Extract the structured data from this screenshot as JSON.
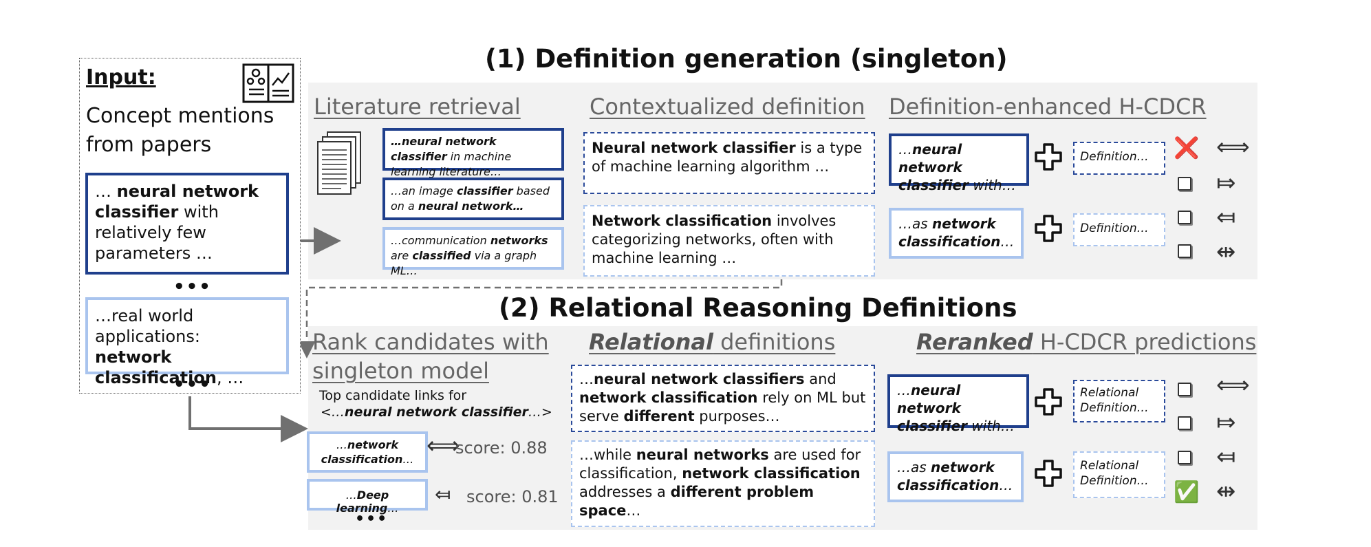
{
  "title1": "(1)   Definition generation (singleton)",
  "title2": "(2) Relational Reasoning Definitions",
  "input": {
    "heading": "Input:",
    "description": "Concept mentions from papers",
    "mention1": {
      "pre": "… ",
      "bold": "neural network classifier",
      "post": " with relatively few parameters …"
    },
    "mention2": {
      "pre": "…real world applications: ",
      "bold": "network classification",
      "post": ", …"
    },
    "dots": "•••"
  },
  "lit": {
    "header": "Literature retrieval",
    "snip1": {
      "bold": "…neural network classifier",
      "post": " in machine learning literature…"
    },
    "snip2": {
      "pre": "…an image ",
      "bold1": "classifier",
      "mid": " based on a ",
      "bold2": "neural network…"
    },
    "snip3": {
      "pre": "…communication ",
      "bold1": "networks",
      "mid": " are ",
      "bold2": "classified",
      "post": " via a graph ML…"
    }
  },
  "ctx": {
    "header": "Contextualized definition",
    "def1": {
      "bold": "Neural network classifier",
      "post": " is a type of machine learning algorithm …"
    },
    "def2": {
      "bold": "Network classification",
      "post": " involves categorizing networks, often with machine learning …"
    }
  },
  "enh": {
    "header": "Definition-enhanced H-CDCR",
    "m1": {
      "pre": "…",
      "bold": "neural network classifier",
      "post": " with…"
    },
    "m2": {
      "pre": "…as ",
      "bold": "network classification",
      "post": "…"
    },
    "def_label": "Definition…",
    "wrong_mark": "❌"
  },
  "rank": {
    "header1": "Rank candidates with",
    "header2": "singleton model",
    "top_label": "Top candidate links for",
    "top_target": {
      "pre": "<…",
      "bold": "neural network classifier",
      "post": "…>"
    },
    "cand1": {
      "pre": "…",
      "bold": "network classification",
      "post": "…",
      "score": "score: 0.88"
    },
    "cand2": {
      "pre": "…",
      "bold": "Deep learning",
      "post": "…",
      "score": "score: 0.81"
    },
    "dots": "•••"
  },
  "reldef": {
    "header_bold": "Relational",
    "header_rest": " definitions",
    "def1": {
      "p1": "…",
      "b1": "neural network classifiers",
      "p2": " and ",
      "b2": "network classification",
      "p3": " rely on ML but serve ",
      "b3": "different",
      "p4": " purposes…"
    },
    "def2": {
      "p1": "…while ",
      "b1": "neural networks",
      "p2": " are used for classification, ",
      "b2": "network classification",
      "p3": " addresses a ",
      "b3": "different problem space",
      "p4": "…"
    }
  },
  "rerank": {
    "header_bold": "Reranked",
    "header_rest": " H-CDCR predictions",
    "m1": {
      "pre": "…",
      "bold": "neural network classifier",
      "post": " with…"
    },
    "m2": {
      "pre": "…as ",
      "bold": "network classification",
      "post": "…"
    },
    "def_label": "Relational Definition…",
    "correct_mark": "✅"
  },
  "relations": [
    "⟺",
    "⤇",
    "⤆",
    "⇹"
  ],
  "colors": {
    "dark_blue": "#1f3f8c",
    "light_blue": "#a9c4ee",
    "panel": "#f2f2f2",
    "wrong": "#e02020",
    "correct": "#3aa845"
  }
}
